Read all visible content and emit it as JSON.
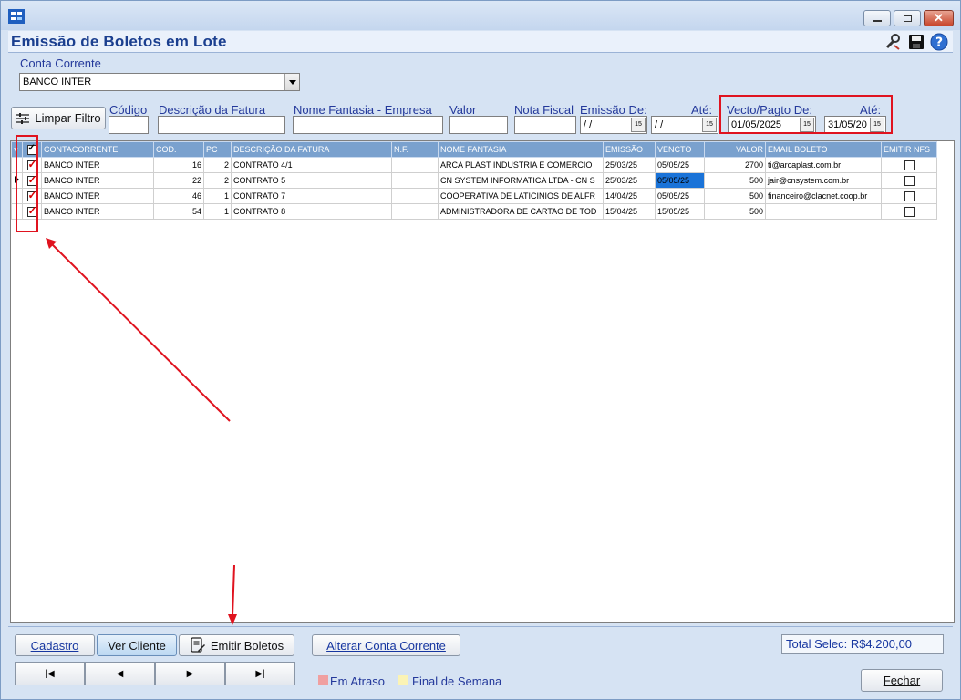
{
  "window": {
    "title": "Emissão de Boletos em Lote",
    "controls": [
      "minimize-icon",
      "maximize-icon",
      "close-icon"
    ],
    "header_icons": [
      "tools-icon",
      "save-icon",
      "help-icon"
    ]
  },
  "conta_corrente": {
    "label": "Conta Corrente",
    "value": "BANCO INTER"
  },
  "filters": {
    "clear_button": "Limpar Filtro",
    "codigo": {
      "label": "Código",
      "value": ""
    },
    "descricao": {
      "label": "Descrição da Fatura",
      "value": ""
    },
    "nome_fantasia": {
      "label": "Nome Fantasia - Empresa",
      "value": ""
    },
    "valor": {
      "label": "Valor",
      "value": ""
    },
    "nota_fiscal": {
      "label": "Nota Fiscal",
      "value": ""
    },
    "emissao_de": {
      "label": "Emissão De:",
      "value": " / /"
    },
    "emissao_ate": {
      "label": "Até:",
      "value": " / /"
    },
    "vecto_de": {
      "label": "Vecto/Pagto De:",
      "value": "01/05/2025"
    },
    "vecto_ate": {
      "label": "Até:",
      "value": "31/05/20"
    },
    "calendar_glyph": "15"
  },
  "grid": {
    "columns": [
      "CONTACORRENTE",
      "COD.",
      "PC",
      "DESCRIÇÃO DA FATURA",
      "N.F.",
      "NOME FANTASIA",
      "EMISSÃO",
      "VENCTO",
      "VALOR",
      "EMAIL BOLETO",
      "EMITIR NFS"
    ],
    "rows": [
      {
        "selected": true,
        "current": false,
        "conta": "BANCO INTER",
        "cod": "16",
        "pc": "2",
        "descricao": "CONTRATO 4/1",
        "nf": "",
        "nome": "ARCA PLAST INDUSTRIA E COMERCIO",
        "emissao": "25/03/25",
        "vencto": "05/05/25",
        "valor": "2700",
        "email": "ti@arcaplast.com.br",
        "emitir_nfs": false
      },
      {
        "selected": true,
        "current": true,
        "conta": "BANCO INTER",
        "cod": "22",
        "pc": "2",
        "descricao": "CONTRATO 5",
        "nf": "",
        "nome": "CN SYSTEM INFORMATICA LTDA - CN S",
        "emissao": "25/03/25",
        "vencto": "05/05/25",
        "valor": "500",
        "email": "jair@cnsystem.com.br",
        "emitir_nfs": false
      },
      {
        "selected": true,
        "current": false,
        "conta": "BANCO INTER",
        "cod": "46",
        "pc": "1",
        "descricao": "CONTRATO 7",
        "nf": "",
        "nome": "COOPERATIVA DE LATICINIOS DE ALFR",
        "emissao": "14/04/25",
        "vencto": "05/05/25",
        "valor": "500",
        "email": "financeiro@clacnet.coop.br",
        "emitir_nfs": false
      },
      {
        "selected": true,
        "current": false,
        "conta": "BANCO INTER",
        "cod": "54",
        "pc": "1",
        "descricao": "CONTRATO 8",
        "nf": "",
        "nome": "ADMINISTRADORA DE CARTAO DE TOD",
        "emissao": "15/04/25",
        "vencto": "15/05/25",
        "valor": "500",
        "email": "",
        "emitir_nfs": false
      }
    ]
  },
  "actions": {
    "cadastro": "Cadastro",
    "ver_cliente": "Ver Cliente",
    "emitir_boletos": "Emitir Boletos",
    "alterar_conta": "Alterar Conta Corrente",
    "fechar": "Fechar"
  },
  "navigation": [
    "first-record-icon",
    "previous-record-icon",
    "next-record-icon",
    "last-record-icon"
  ],
  "total": "Total Selec: R$4.200,00",
  "legend": {
    "em_atraso": {
      "label": "Em Atraso",
      "color": "#f0a0a0"
    },
    "final_semana": {
      "label": "Final de Semana",
      "color": "#fbf3b5"
    }
  },
  "colors": {
    "header_blue": "#7aa1ce",
    "title_blue": "#1b3f8f",
    "selected_cell": "#1a73d8",
    "annotation_red": "#e0131f"
  }
}
